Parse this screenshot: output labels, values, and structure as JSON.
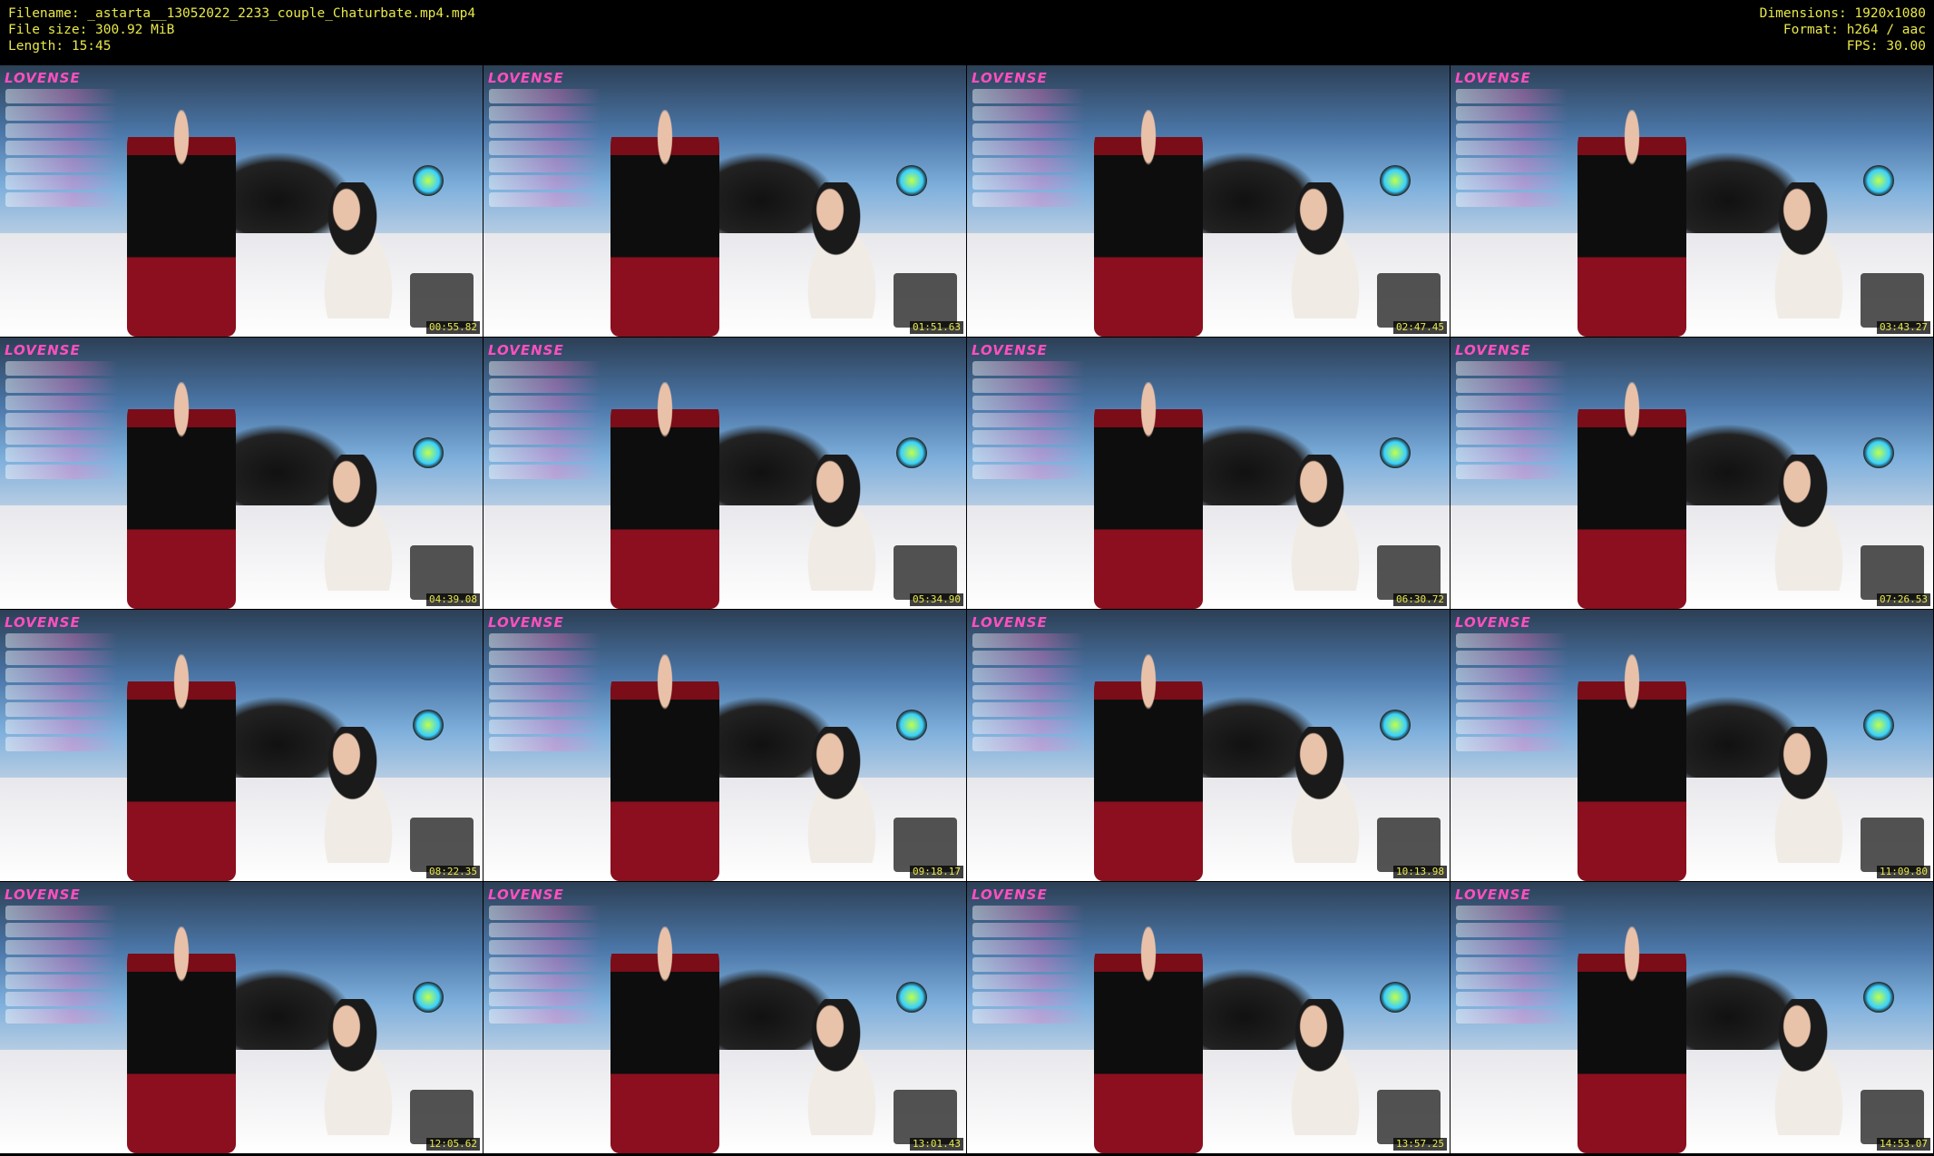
{
  "header": {
    "filename": "Filename: _astarta__13052022_2233_couple_Chaturbate.mp4.mp4",
    "filesize": "File size: 300.92 MiB",
    "length": "Length: 15:45",
    "dimensions": "Dimensions: 1920x1080",
    "format": "Format: h264 / aac",
    "fps": "FPS: 30.00"
  },
  "overlay_brand": "LOVENSE",
  "thumbnails": [
    {
      "timestamp": "00:55.82"
    },
    {
      "timestamp": "01:51.63"
    },
    {
      "timestamp": "02:47.45"
    },
    {
      "timestamp": "03:43.27"
    },
    {
      "timestamp": "04:39.08"
    },
    {
      "timestamp": "05:34.90"
    },
    {
      "timestamp": "06:30.72"
    },
    {
      "timestamp": "07:26.53"
    },
    {
      "timestamp": "08:22.35"
    },
    {
      "timestamp": "09:18.17"
    },
    {
      "timestamp": "10:13.98"
    },
    {
      "timestamp": "11:09.80"
    },
    {
      "timestamp": "12:05.62"
    },
    {
      "timestamp": "13:01.43"
    },
    {
      "timestamp": "13:57.25"
    },
    {
      "timestamp": "14:53.07"
    }
  ],
  "colors": {
    "header_text": "#e8e84a",
    "background": "#000000",
    "brand": "#ff4fbf"
  }
}
